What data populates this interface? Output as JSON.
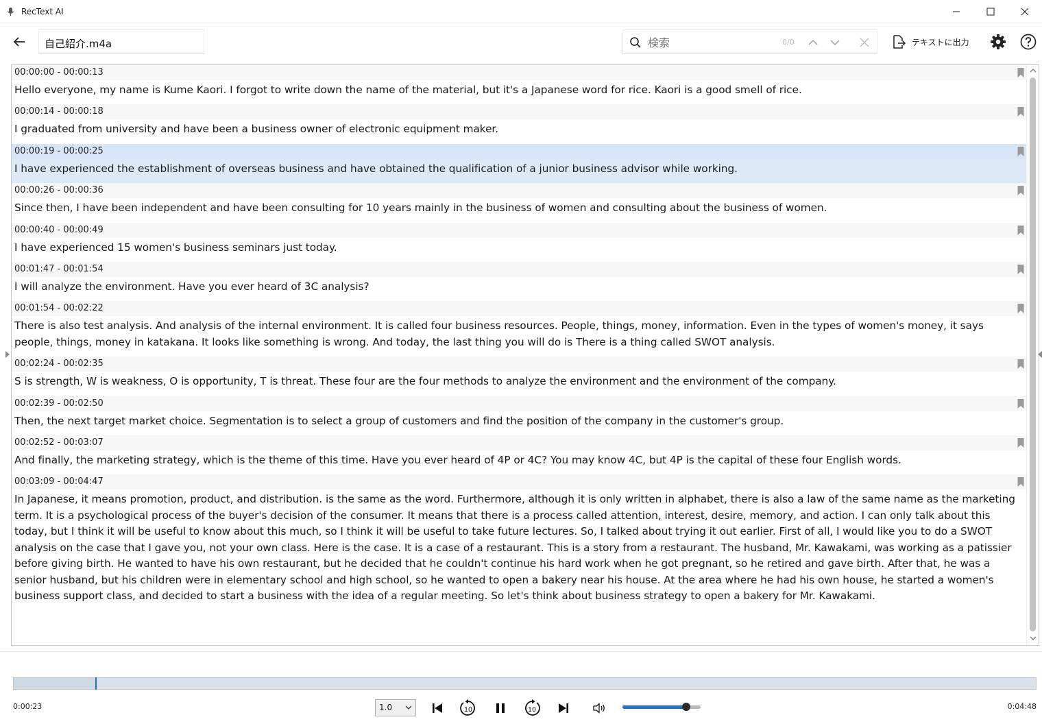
{
  "window": {
    "app_title": "RecText AI"
  },
  "toolbar": {
    "file_name": "自己紹介.m4a",
    "search_placeholder": "検索",
    "search_count": "0/0",
    "export_label": "テキストに出力"
  },
  "transcript": {
    "selected_index": 2,
    "segments": [
      {
        "time": "00:00:00 - 00:00:13",
        "text": "Hello everyone, my name is Kume Kaori. I forgot to write down the name of the material, but it's a Japanese word for rice. Kaori is a good smell of rice."
      },
      {
        "time": "00:00:14 - 00:00:18",
        "text": "I graduated from university and have been a business owner of electronic equipment maker."
      },
      {
        "time": "00:00:19 - 00:00:25",
        "text": "I have experienced the establishment of overseas business and have obtained the qualification of a junior business advisor while working."
      },
      {
        "time": "00:00:26 - 00:00:36",
        "text": "Since then, I have been independent and have been consulting for 10 years mainly in the business of women and consulting about the business of women."
      },
      {
        "time": "00:00:40 - 00:00:49",
        "text": "I have experienced 15 women's business seminars just today."
      },
      {
        "time": "00:01:47 - 00:01:54",
        "text": "I will analyze the environment. Have you ever heard of 3C analysis?"
      },
      {
        "time": "00:01:54 - 00:02:22",
        "text": "There is also test analysis. And analysis of the internal environment. It is called four business resources. People, things, money, information. Even in the types of women's money, it says people, things, money in katakana. It looks like something is wrong. And today, the last thing you will do is There is a thing called SWOT analysis."
      },
      {
        "time": "00:02:24 - 00:02:35",
        "text": "S is strength, W is weakness, O is opportunity, T is threat. These four are the four methods to analyze the environment and the environment of the company."
      },
      {
        "time": "00:02:39 - 00:02:50",
        "text": "Then, the next target market choice. Segmentation is to select a group of customers and find the position of the company in the customer's group."
      },
      {
        "time": "00:02:52 - 00:03:07",
        "text": "And finally, the marketing strategy, which is the theme of this time. Have you ever heard of 4P or 4C? You may know 4C, but 4P is the capital of these four English words."
      },
      {
        "time": "00:03:09 - 00:04:47",
        "text": "In Japanese, it means promotion, product, and distribution. is the same as the word. Furthermore, although it is only written in alphabet, there is also a law of the same name as the marketing term. It is a psychological process of the buyer's decision of the consumer. It means that there is a process called attention, interest, desire, memory, and action. I can only talk about this today, but I think it will be useful to know about this much, so I think it will be useful to take future lectures. So, I talked about trying it out earlier. First of all, I would like you to do a SWOT analysis on the case that I gave you, not your own class. Here is the case. It is a case of a restaurant. This is a story from a restaurant. The husband, Mr. Kawakami, was working as a patissier before giving birth. He wanted to have his own restaurant, but he decided that he couldn't continue his hard work when he got pregnant, so he retired and gave birth. After that, he was a senior husband, but his children were in elementary school and high school, so he wanted to open a bakery near his house. At the area where he had his own house, he started a women's business support class, and decided to start a business with the idea of a regular meeting. So let's think about business strategy to open a bakery for Mr. Kawakami."
      }
    ]
  },
  "player": {
    "current_time": "0:00:23",
    "total_time": "0:04:48",
    "progress_fraction": 0.08,
    "speed": "1.0",
    "volume_fraction": 0.82,
    "skip_back_seconds": "10",
    "skip_forward_seconds": "10"
  },
  "colors": {
    "accent": "#1e6fd9",
    "selected_row": "#dde9f7",
    "row_header": "#f7f7f7"
  },
  "icons": {
    "title": "microphone-icon",
    "back": "arrow-left-icon",
    "search": "search-icon",
    "prev": "chevron-up-icon",
    "next": "chevron-down-icon",
    "clear": "close-icon",
    "export": "export-document-icon",
    "settings": "gear-icon",
    "help": "help-circle-icon",
    "bookmark": "bookmark-icon",
    "skip_start": "skip-to-start-icon",
    "rewind": "rewind-10-icon",
    "pause": "pause-icon",
    "forward": "forward-10-icon",
    "skip_end": "skip-to-end-icon",
    "volume": "volume-icon"
  }
}
